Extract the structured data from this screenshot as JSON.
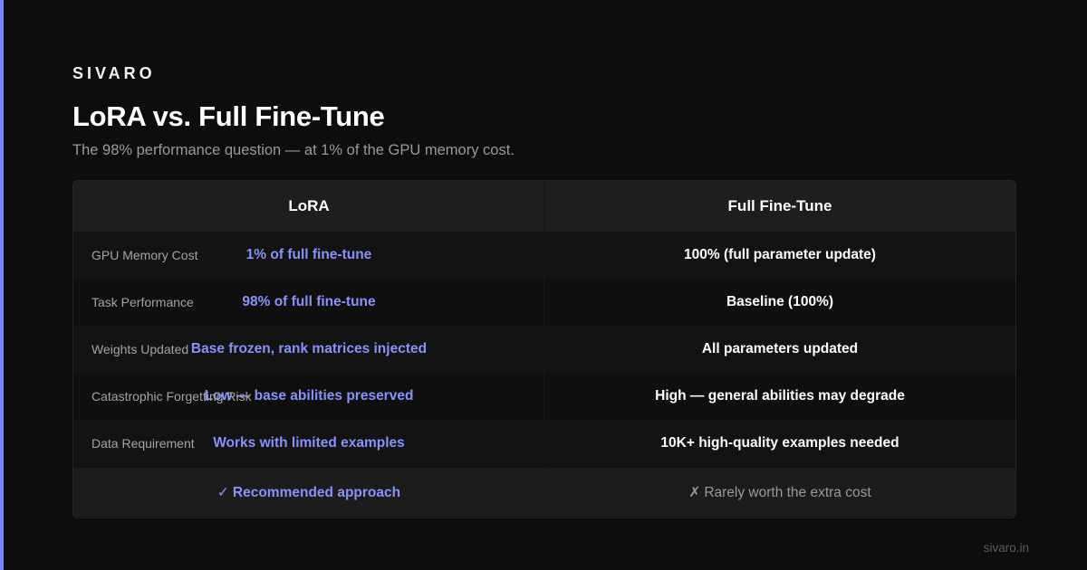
{
  "brand": "SIVARO",
  "title": "LoRA vs. Full Fine-Tune",
  "subtitle": "The 98% performance question — at 1% of the GPU memory cost.",
  "table": {
    "headers": {
      "lora": "LoRA",
      "full": "Full Fine-Tune"
    },
    "rows": [
      {
        "label": "GPU Memory Cost",
        "lora": "1% of full fine-tune",
        "full": "100% (full parameter update)"
      },
      {
        "label": "Task Performance",
        "lora": "98% of full fine-tune",
        "full": "Baseline (100%)"
      },
      {
        "label": "Weights Updated",
        "lora": "Base frozen, rank matrices injected",
        "full": "All parameters updated"
      },
      {
        "label": "Catastrophic Forgetting Risk",
        "lora": "Low — base abilities preserved",
        "full": "High — general abilities may degrade"
      },
      {
        "label": "Data Requirement",
        "lora": "Works with limited examples",
        "full": "10K+ high-quality examples needed"
      }
    ],
    "footer": {
      "lora_icon": "✓",
      "lora": "Recommended approach",
      "full_icon": "✗",
      "full": "Rarely worth the extra cost"
    }
  },
  "site": "sivaro.in",
  "colors": {
    "accent": "#7b85f5",
    "lora_text": "#8a92f7",
    "background": "#0d0d0d"
  },
  "icons": {
    "recommended": "check-icon",
    "not_recommended": "cross-icon"
  }
}
